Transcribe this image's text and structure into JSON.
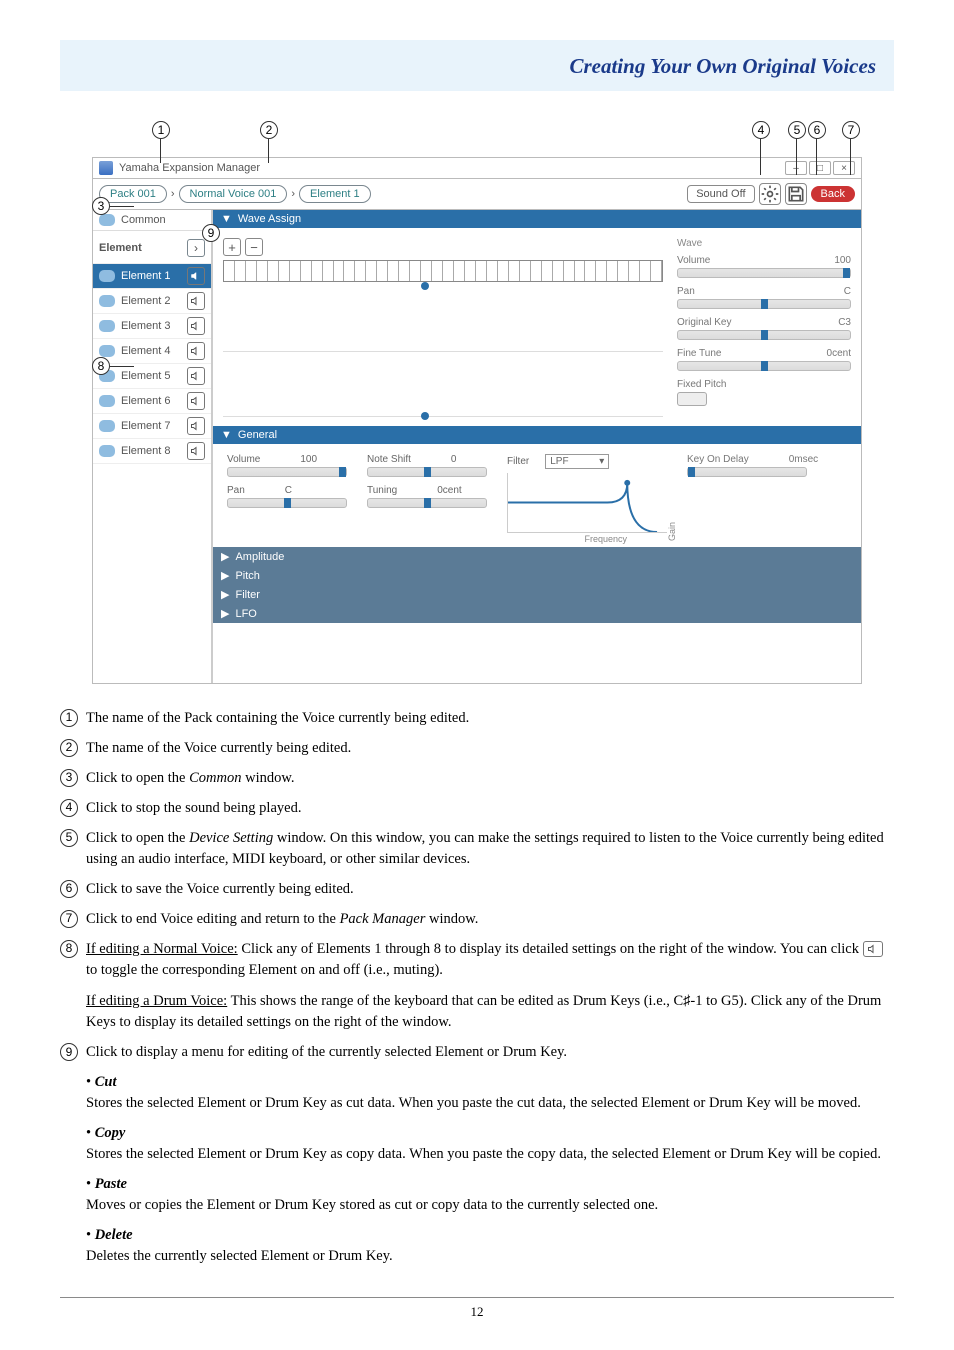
{
  "header": {
    "title": "Creating Your Own Original Voices"
  },
  "shot": {
    "window_title": "Yamaha Expansion Manager",
    "breadcrumbs": {
      "pack": "Pack 001",
      "voice": "Normal Voice 001",
      "element": "Element 1"
    },
    "toolbar": {
      "sound_off": "Sound Off",
      "back": "Back"
    },
    "sidebar": {
      "common": "Common",
      "element_head": "Element",
      "items": [
        {
          "label": "Element 1",
          "selected": true
        },
        {
          "label": "Element 2",
          "selected": false
        },
        {
          "label": "Element 3",
          "selected": false
        },
        {
          "label": "Element 4",
          "selected": false
        },
        {
          "label": "Element 5",
          "selected": false
        },
        {
          "label": "Element 6",
          "selected": false
        },
        {
          "label": "Element 7",
          "selected": false
        },
        {
          "label": "Element 8",
          "selected": false
        }
      ]
    },
    "sections": {
      "wave_assign": "Wave Assign",
      "general": "General",
      "amplitude": "Amplitude",
      "pitch": "Pitch",
      "filter": "Filter",
      "lfo": "LFO"
    },
    "wave": {
      "title": "Wave",
      "volume_label": "Volume",
      "volume_val": "100",
      "pan_label": "Pan",
      "pan_val": "C",
      "origkey_label": "Original Key",
      "origkey_val": "C3",
      "finetune_label": "Fine Tune",
      "finetune_val": "0cent",
      "fixedpitch_label": "Fixed Pitch"
    },
    "general": {
      "volume_label": "Volume",
      "volume_val": "100",
      "noteshift_label": "Note Shift",
      "noteshift_val": "0",
      "pan_label": "Pan",
      "pan_val": "C",
      "tuning_label": "Tuning",
      "tuning_val": "0cent",
      "filter_label": "Filter",
      "filter_sel": "LPF",
      "kod_label": "Key On Delay",
      "kod_val": "0msec",
      "freq_label": "Frequency",
      "gain_label": "Gain"
    }
  },
  "legend": {
    "i1": "The name of the Pack containing the Voice currently being edited.",
    "i2": "The name of the Voice currently being edited.",
    "i3_a": "Click to open the ",
    "i3_em": "Common",
    "i3_b": " window.",
    "i4": "Click to stop the sound being played.",
    "i5_a": "Click to open the ",
    "i5_em": "Device Setting",
    "i5_b": " window. On this window, you can make the settings required to listen to the Voice currently being edited using an audio interface, MIDI keyboard, or other similar devices.",
    "i6": "Click to save the Voice currently being edited.",
    "i7_a": "Click to end Voice editing and return to the ",
    "i7_em": "Pack Manager",
    "i7_b": " window.",
    "i8_u1": "If editing a Normal Voice:",
    "i8_a": " Click any of Elements 1 through 8 to display its detailed settings on the right of the window. You can click ",
    "i8_b": " to toggle the corresponding Element on and off (i.e., muting).",
    "i8_u2": "If editing a Drum Voice:",
    "i8_c": " This shows the range of the keyboard that can be edited as Drum Keys (i.e., C♯-1 to G5). Click any of the Drum Keys to display its detailed settings on the right of the window.",
    "i9": "Click to display a menu for editing of the currently selected Element or Drum Key.",
    "cut_h": "Cut",
    "cut_b": "Stores the selected Element or Drum Key as cut data. When you paste the cut data, the selected Element or Drum Key will be moved.",
    "copy_h": "Copy",
    "copy_b": "Stores the selected Element or Drum Key as copy data. When you paste the copy data, the selected Element or Drum Key will be copied.",
    "paste_h": "Paste",
    "paste_b": "Moves or copies the Element or Drum Key stored as cut or copy data to the currently selected one.",
    "del_h": "Delete",
    "del_b": "Deletes the currently selected Element or Drum Key."
  },
  "page_number": "12"
}
